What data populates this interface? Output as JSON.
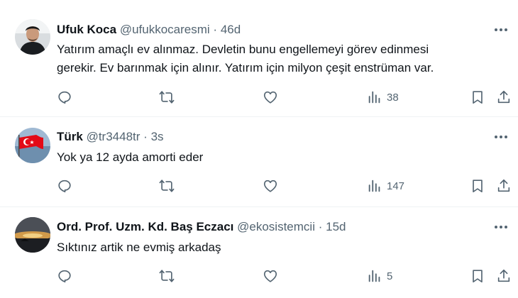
{
  "tweets": [
    {
      "name": "Ufuk Koca",
      "handle": "@ufukkocaresmi",
      "separator": "·",
      "time": "46d",
      "text_lines": [
        "Yatırım amaçlı ev alınmaz. Devletin bunu engellemeyi görev edinmesi",
        "gerekir. Ev barınmak için alınır. Yatırım için milyon çeşit enstrüman var."
      ],
      "views": "38"
    },
    {
      "name": "Türk",
      "handle": "@tr3448tr",
      "separator": "·",
      "time": "3s",
      "text_lines": [
        "Yok ya 12 ayda amorti eder"
      ],
      "views": "147"
    },
    {
      "name": "Ord. Prof. Uzm. Kd. Baş Eczacı",
      "handle": "@ekosistemcii",
      "separator": "·",
      "time": "15d",
      "text_lines": [
        "Sıktınız artik ne evmiş arkadaş"
      ],
      "views": "5"
    }
  ],
  "icons": {
    "reply": "reply-icon",
    "retweet": "retweet-icon",
    "like": "heart-icon",
    "views": "views-icon",
    "bookmark": "bookmark-icon",
    "share": "share-icon",
    "more": "more-icon"
  },
  "colors": {
    "text": "#0f1419",
    "secondary": "#536471",
    "divider": "#eff3f4"
  }
}
